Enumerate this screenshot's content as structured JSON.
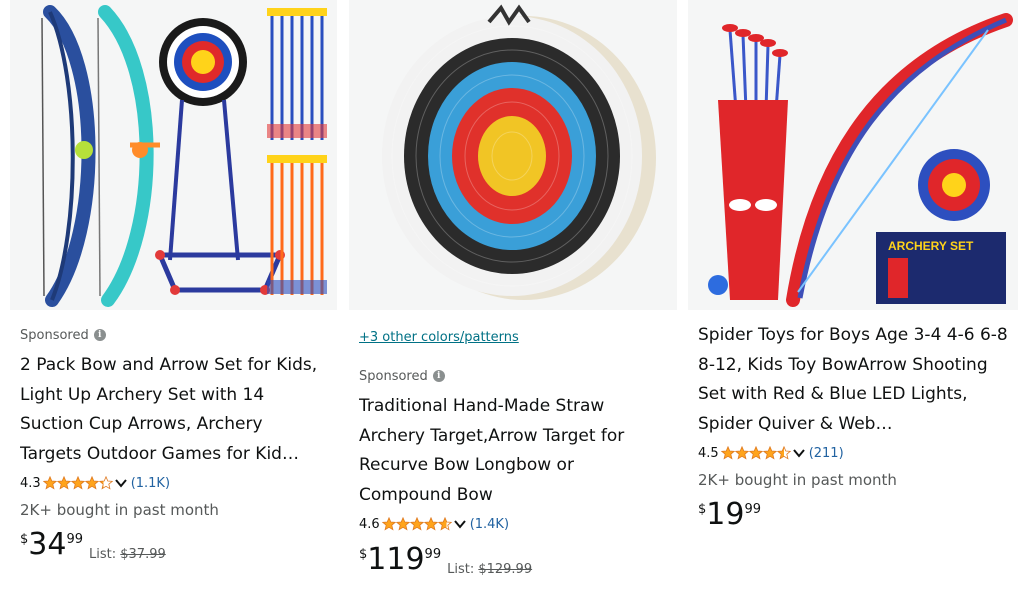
{
  "products": [
    {
      "sponsored": "Sponsored",
      "title": "2 Pack Bow and Arrow Set for Kids, Light Up Archery Set with 14 Suction Cup Arrows, Archery Targets Outdoor Games for Kid…",
      "rating": "4.3",
      "rating_value": 4.3,
      "review_count": "(1.1K)",
      "bought": "2K+ bought in past month",
      "price_symbol": "$",
      "price_whole": "34",
      "price_fraction": "99",
      "list_label": "List:",
      "list_price": "$37.99",
      "image_icon": "bow-and-arrow-target-image"
    },
    {
      "colors_link": "+3 other colors/patterns",
      "sponsored": "Sponsored",
      "title": "Traditional Hand-Made Straw Archery Target,Arrow Target for Recurve Bow Longbow or Compound Bow",
      "rating": "4.6",
      "rating_value": 4.6,
      "review_count": "(1.4K)",
      "price_symbol": "$",
      "price_whole": "119",
      "price_fraction": "99",
      "list_label": "List:",
      "list_price": "$129.99",
      "image_icon": "straw-target-image"
    },
    {
      "title": "Spider Toys for Boys Age 3-4 4-6 6-8 8-12, Kids Toy BowArrow Shooting Set with Red & Blue LED Lights, Spider Quiver & Web…",
      "rating": "4.5",
      "rating_value": 4.5,
      "review_count": "(211)",
      "bought": "2K+ bought in past month",
      "price_symbol": "$",
      "price_whole": "19",
      "price_fraction": "99",
      "image_icon": "spider-bow-set-image",
      "image_box_text": "ARCHERY SET"
    }
  ],
  "colors": {
    "star": "#ffa41c",
    "link": "#2162a1",
    "teal_link": "#007185",
    "muted": "#565959",
    "text": "#0f1111"
  }
}
